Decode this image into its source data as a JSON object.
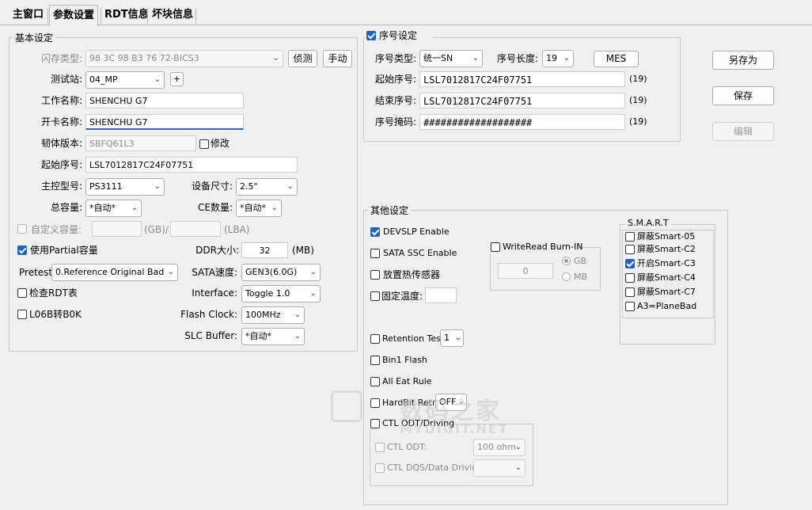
{
  "tabs": [
    {
      "label": "主窗口"
    },
    {
      "label": "参数设置"
    },
    {
      "label": "RDT信息"
    },
    {
      "label": "坏块信息"
    }
  ],
  "basic": {
    "title": "基本设定",
    "flash_type_label": "闪存类型:",
    "flash_type_value": "98 3C 98 B3 76 72-BICS3",
    "detect_button": "侦测",
    "manual_button": "手动",
    "station_label": "测试站:",
    "station_value": "04_MP",
    "plus_button": "+",
    "work_name_label": "工作名称:",
    "work_name_value": "SHENCHU G7",
    "card_name_label": "开卡名称:",
    "card_name_value": "SHENCHU G7",
    "fw_label": "韧体版本:",
    "fw_value": "SBFQ61L3",
    "modify_label": "修改",
    "start_sn_label": "起始序号:",
    "start_sn_value": "LSL7012817C24F07751",
    "controller_label": "主控型号:",
    "controller_value": "PS3111",
    "device_size_label": "设备尺寸:",
    "device_size_value": "2.5\"",
    "capacity_label": "总容量:",
    "capacity_value": "*自动*",
    "ce_label": "CE数量:",
    "ce_value": "*自动*",
    "custom_cap_label": "自定义容量:",
    "gb_unit": "(GB)/",
    "lba_unit": "(LBA)",
    "use_partial_label": "使用Partial容量",
    "use_partial_checked": true,
    "ddr_label": "DDR大小:",
    "ddr_value": "32",
    "ddr_unit": "(MB)",
    "pretest_label": "Pretest:",
    "pretest_value": "0.Reference Original Bad",
    "sata_label": "SATA速度:",
    "sata_value": "GEN3(6.0G)",
    "rdt_check_label": "检查RDT表",
    "interface_label": "Interface:",
    "interface_value": "Toggle 1.0",
    "l06b_label": "L06B转B0K",
    "flash_clock_label": "Flash Clock:",
    "flash_clock_value": "100MHz",
    "slc_label": "SLC Buffer:",
    "slc_value": "*自动*"
  },
  "serial": {
    "title": "序号设定",
    "enabled": true,
    "type_label": "序号类型:",
    "type_value": "统一SN",
    "length_label": "序号长度:",
    "length_value": "19",
    "mes_button": "MES",
    "start_label": "起始序号:",
    "start_value": "LSL7012817C24F07751",
    "start_count": "(19)",
    "end_label": "结束序号:",
    "end_value": "LSL7012817C24F07751",
    "end_count": "(19)",
    "mask_label": "序号掩码:",
    "mask_value": "###################",
    "mask_count": "(19)"
  },
  "actions": {
    "save_as": "另存为",
    "save": "保存",
    "edit": "编辑"
  },
  "other": {
    "title": "其他设定",
    "devslp_label": "DEVSLP Enable",
    "sata_ssc_label": "SATA SSC Enable",
    "thermal_label": "放置热传感器",
    "fixed_temp_label": "固定温度:",
    "writeread_label": "WriteRead Burn-IN",
    "writeread_value": "0",
    "gb_label": "GB",
    "mb_label": "MB",
    "retention_label": "Retention Test",
    "retention_value": "1",
    "bin1_label": "Bin1 Flash",
    "all_eat_label": "All Eat Rule",
    "hardbit_label": "HardBit Retry",
    "hardbit_value": "OFF",
    "ctl_odt_driving_label": "CTL ODT/Driving",
    "ctl_odt_label": "CTL ODT:",
    "ctl_odt_value": "100 ohm",
    "ctl_dqs_label": "CTL DQS/Data Driving:"
  },
  "smart": {
    "title": "S.M.A.R.T",
    "items": [
      {
        "label": "屏蔽Smart-05",
        "checked": false
      },
      {
        "label": "屏蔽Smart-C2",
        "checked": false
      },
      {
        "label": "开启Smart-C3",
        "checked": true
      },
      {
        "label": "屏蔽Smart-C4",
        "checked": false
      },
      {
        "label": "屏蔽Smart-C7",
        "checked": false
      },
      {
        "label": "A3=PlaneBad",
        "checked": false
      }
    ]
  },
  "watermark": {
    "line1": "数码之家",
    "line2": "MYDIGIT.NET"
  }
}
